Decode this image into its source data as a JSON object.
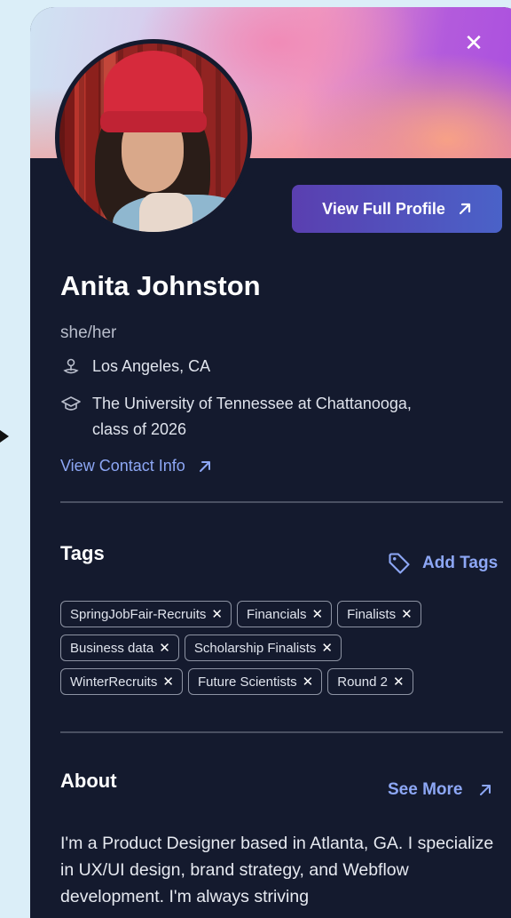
{
  "header": {
    "close_label": "✕",
    "view_full_profile_label": "View Full Profile"
  },
  "profile": {
    "name": "Anita Johnston",
    "pronouns": "she/her",
    "location": "Los Angeles, CA",
    "education_line1": "The University of Tennessee at Chattanooga,",
    "education_line2": "class of 2026",
    "contact_link_label": "View Contact Info"
  },
  "tags_section": {
    "title": "Tags",
    "add_label": "Add Tags",
    "rows": [
      [
        "SpringJobFair-Recruits",
        "Financials",
        "Finalists"
      ],
      [
        "Business data",
        "Scholarship Finalists"
      ],
      [
        "WinterRecruits",
        "Future Scientists",
        "Round 2"
      ]
    ],
    "remove_symbol": "✕"
  },
  "about_section": {
    "title": "About",
    "see_more_label": "See More",
    "text": "I'm a Product Designer based in Atlanta, GA. I specialize in UX/UI design, brand strategy, and Webflow development. I'm always striving"
  },
  "colors": {
    "card_bg": "#141a2e",
    "accent_link": "#8da7f5",
    "button_gradient_start": "#5a3fb0",
    "button_gradient_end": "#4a62c8",
    "page_bg": "#dbeef8"
  }
}
